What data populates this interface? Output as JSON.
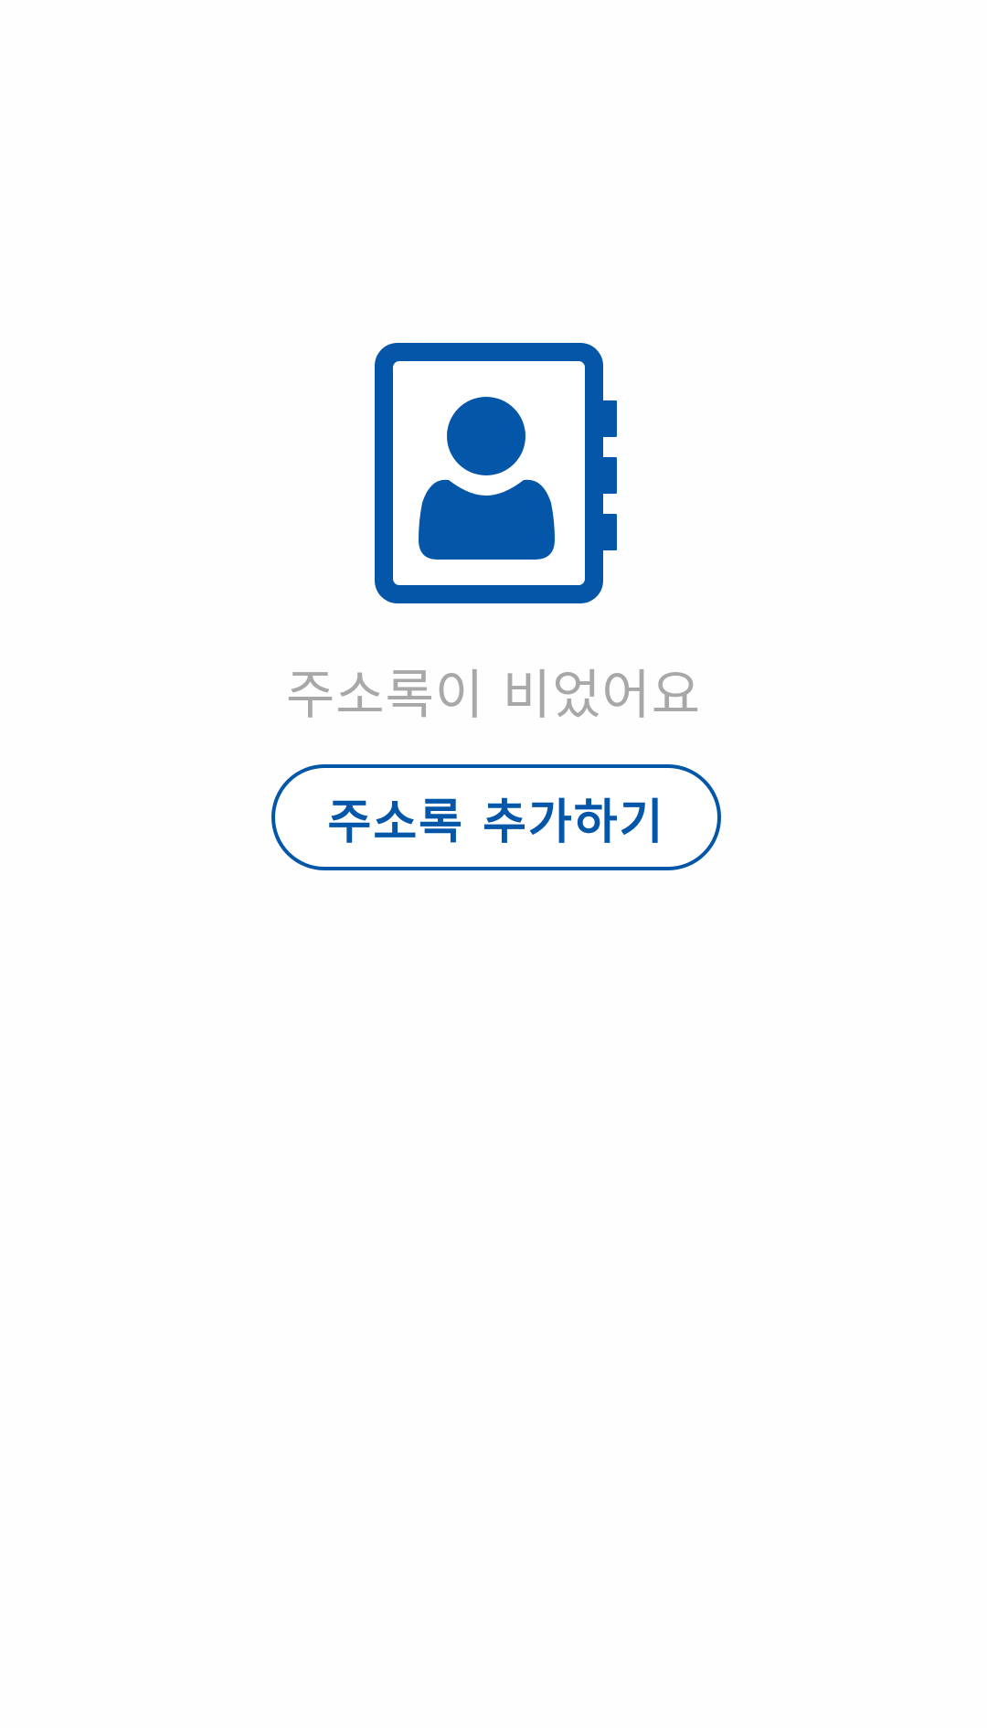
{
  "screen": {
    "background_color": "#fefefe"
  },
  "empty_state": {
    "icon": "address-book-icon",
    "icon_color": "#0457a8",
    "message": "주소록이 비었어요",
    "message_color": "#a8a8a8",
    "add_button_label": "주소록 추가하기",
    "accent_color": "#0457a8"
  }
}
